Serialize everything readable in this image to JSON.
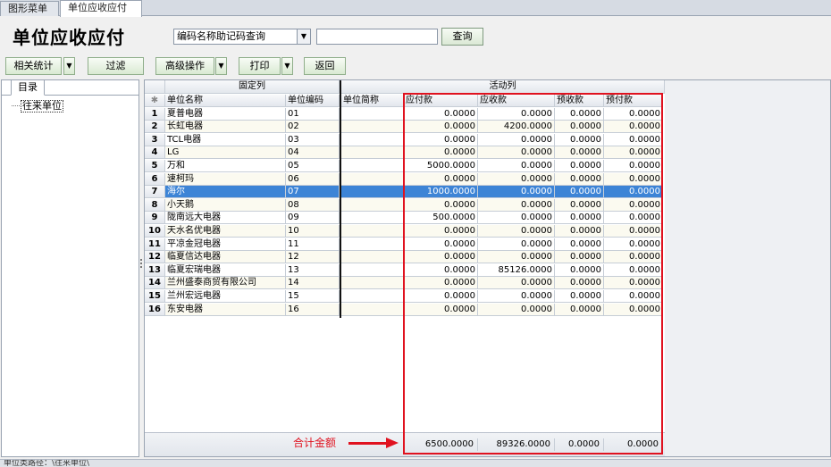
{
  "tabs": [
    "图形菜单",
    "单位应收应付"
  ],
  "page_title": "单位应收应付",
  "search": {
    "mode_value": "编码名称助记码查询",
    "input_value": "",
    "query_label": "查询"
  },
  "toolbar": {
    "related_stats": "相关统计",
    "filter": "过滤",
    "advanced": "高级操作",
    "print": "打印",
    "back": "返回"
  },
  "sidebar": {
    "tab_label": "目录",
    "tree_item": "往来单位"
  },
  "grid": {
    "group_fixed": "固定列",
    "group_active": "活动列",
    "row_marker": "✱",
    "columns": [
      "单位名称",
      "单位编码",
      "单位简称",
      "应付款",
      "应收款",
      "预收款",
      "预付款"
    ],
    "selected_row": 7,
    "rows": [
      {
        "no": "1",
        "name": "夏普电器",
        "code": "01",
        "short": "",
        "payable": "0.0000",
        "receivable": "0.0000",
        "adv_recv": "0.0000",
        "adv_pay": "0.0000"
      },
      {
        "no": "2",
        "name": "长虹电器",
        "code": "02",
        "short": "",
        "payable": "0.0000",
        "receivable": "4200.0000",
        "adv_recv": "0.0000",
        "adv_pay": "0.0000"
      },
      {
        "no": "3",
        "name": "TCL电器",
        "code": "03",
        "short": "",
        "payable": "0.0000",
        "receivable": "0.0000",
        "adv_recv": "0.0000",
        "adv_pay": "0.0000"
      },
      {
        "no": "4",
        "name": "LG",
        "code": "04",
        "short": "",
        "payable": "0.0000",
        "receivable": "0.0000",
        "adv_recv": "0.0000",
        "adv_pay": "0.0000"
      },
      {
        "no": "5",
        "name": "万和",
        "code": "05",
        "short": "",
        "payable": "5000.0000",
        "receivable": "0.0000",
        "adv_recv": "0.0000",
        "adv_pay": "0.0000"
      },
      {
        "no": "6",
        "name": "速柯玛",
        "code": "06",
        "short": "",
        "payable": "0.0000",
        "receivable": "0.0000",
        "adv_recv": "0.0000",
        "adv_pay": "0.0000"
      },
      {
        "no": "7",
        "name": "海尔",
        "code": "07",
        "short": "",
        "payable": "1000.0000",
        "receivable": "0.0000",
        "adv_recv": "0.0000",
        "adv_pay": "0.0000"
      },
      {
        "no": "8",
        "name": "小天鹅",
        "code": "08",
        "short": "",
        "payable": "0.0000",
        "receivable": "0.0000",
        "adv_recv": "0.0000",
        "adv_pay": "0.0000"
      },
      {
        "no": "9",
        "name": "陇南远大电器",
        "code": "09",
        "short": "",
        "payable": "500.0000",
        "receivable": "0.0000",
        "adv_recv": "0.0000",
        "adv_pay": "0.0000"
      },
      {
        "no": "10",
        "name": "天水名优电器",
        "code": "10",
        "short": "",
        "payable": "0.0000",
        "receivable": "0.0000",
        "adv_recv": "0.0000",
        "adv_pay": "0.0000"
      },
      {
        "no": "11",
        "name": "平凉金冠电器",
        "code": "11",
        "short": "",
        "payable": "0.0000",
        "receivable": "0.0000",
        "adv_recv": "0.0000",
        "adv_pay": "0.0000"
      },
      {
        "no": "12",
        "name": "临夏信达电器",
        "code": "12",
        "short": "",
        "payable": "0.0000",
        "receivable": "0.0000",
        "adv_recv": "0.0000",
        "adv_pay": "0.0000"
      },
      {
        "no": "13",
        "name": "临夏宏瑞电器",
        "code": "13",
        "short": "",
        "payable": "0.0000",
        "receivable": "85126.0000",
        "adv_recv": "0.0000",
        "adv_pay": "0.0000"
      },
      {
        "no": "14",
        "name": "兰州盛泰商贸有限公司",
        "code": "14",
        "short": "",
        "payable": "0.0000",
        "receivable": "0.0000",
        "adv_recv": "0.0000",
        "adv_pay": "0.0000"
      },
      {
        "no": "15",
        "name": "兰州宏远电器",
        "code": "15",
        "short": "",
        "payable": "0.0000",
        "receivable": "0.0000",
        "adv_recv": "0.0000",
        "adv_pay": "0.0000"
      },
      {
        "no": "16",
        "name": "东安电器",
        "code": "16",
        "short": "",
        "payable": "0.0000",
        "receivable": "0.0000",
        "adv_recv": "0.0000",
        "adv_pay": "0.0000"
      }
    ],
    "totals": {
      "label": "合计金额",
      "payable": "6500.0000",
      "receivable": "89326.0000",
      "adv_recv": "0.0000",
      "adv_pay": "0.0000"
    }
  },
  "status_text": "单位类路径：\\往来单位\\",
  "colors": {
    "selected_row": "#3d84d6",
    "annotation_red": "#e0121f"
  }
}
